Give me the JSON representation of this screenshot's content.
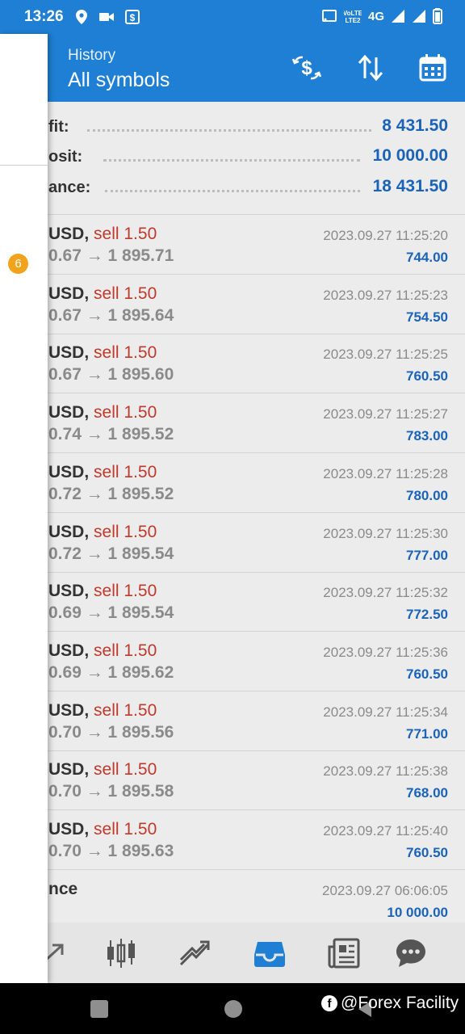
{
  "status_bar": {
    "time": "13:26",
    "network": "4G",
    "left_icons": [
      "location-icon",
      "video-icon",
      "dollar-square-icon"
    ],
    "right_icons": [
      "cast-icon",
      "volte-icon",
      "signal-icon",
      "signal-icon",
      "battery-icon"
    ]
  },
  "app_bar": {
    "subtitle": "History",
    "title": "All symbols",
    "actions": [
      "currency-exchange-icon",
      "sort-icon",
      "calendar-icon"
    ]
  },
  "summary": [
    {
      "label": "Profit:",
      "visible_label": "fit:",
      "value": "8 431.50"
    },
    {
      "label": "Deposit:",
      "visible_label": "osit:",
      "value": "10 000.00"
    },
    {
      "label": "Balance:",
      "visible_label": "ance:",
      "value": "18 431.50"
    }
  ],
  "deals": [
    {
      "symbol": "USD,",
      "side": "sell 1.50",
      "prices": "0.67 → 1 895.71",
      "time": "2023.09.27 11:25:20",
      "profit": "744.00"
    },
    {
      "symbol": "USD,",
      "side": "sell 1.50",
      "prices": "0.67 → 1 895.64",
      "time": "2023.09.27 11:25:23",
      "profit": "754.50"
    },
    {
      "symbol": "USD,",
      "side": "sell 1.50",
      "prices": "0.67 → 1 895.60",
      "time": "2023.09.27 11:25:25",
      "profit": "760.50"
    },
    {
      "symbol": "USD,",
      "side": "sell 1.50",
      "prices": "0.74 → 1 895.52",
      "time": "2023.09.27 11:25:27",
      "profit": "783.00"
    },
    {
      "symbol": "USD,",
      "side": "sell 1.50",
      "prices": "0.72 → 1 895.52",
      "time": "2023.09.27 11:25:28",
      "profit": "780.00"
    },
    {
      "symbol": "USD,",
      "side": "sell 1.50",
      "prices": "0.72 → 1 895.54",
      "time": "2023.09.27 11:25:30",
      "profit": "777.00"
    },
    {
      "symbol": "USD,",
      "side": "sell 1.50",
      "prices": "0.69 → 1 895.54",
      "time": "2023.09.27 11:25:32",
      "profit": "772.50"
    },
    {
      "symbol": "USD,",
      "side": "sell 1.50",
      "prices": "0.69 → 1 895.62",
      "time": "2023.09.27 11:25:36",
      "profit": "760.50"
    },
    {
      "symbol": "USD,",
      "side": "sell 1.50",
      "prices": "0.70 → 1 895.56",
      "time": "2023.09.27 11:25:34",
      "profit": "771.00"
    },
    {
      "symbol": "USD,",
      "side": "sell 1.50",
      "prices": "0.70 → 1 895.58",
      "time": "2023.09.27 11:25:38",
      "profit": "768.00"
    },
    {
      "symbol": "USD,",
      "side": "sell 1.50",
      "prices": "0.70 → 1 895.63",
      "time": "2023.09.27 11:25:40",
      "profit": "760.50"
    }
  ],
  "balance_entry": {
    "label": "nce",
    "time": "2023.09.27 06:06:05",
    "value": "10 000.00"
  },
  "bottom_nav": {
    "items": [
      "quotes-icon",
      "chart-icon",
      "trade-icon",
      "history-icon",
      "news-icon",
      "chat-icon"
    ],
    "active": "history-icon"
  },
  "drawer": {
    "badge": "6"
  },
  "watermark": "@Forex Facility",
  "colors": {
    "primary": "#1f7fd4",
    "profit": "#1a63b8",
    "sell": "#c0392b",
    "badge": "#f2a21b"
  }
}
